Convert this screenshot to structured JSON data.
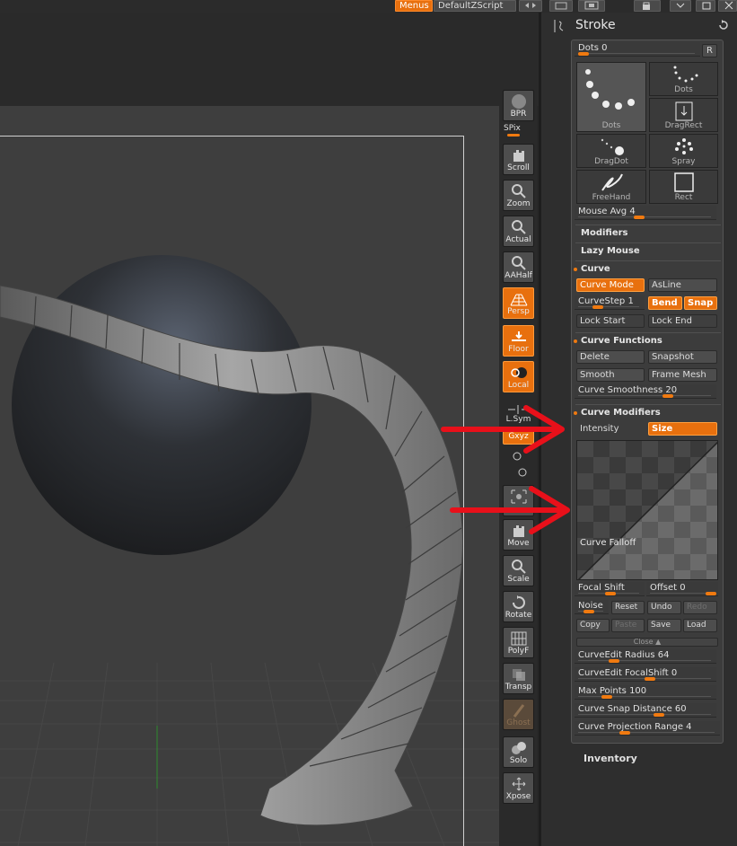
{
  "topbar": {
    "menus": "Menus",
    "script": "DefaultZScript"
  },
  "toolbar": {
    "items": [
      {
        "label": "BPR"
      },
      {
        "label": "SPix"
      },
      {
        "label": "Scroll"
      },
      {
        "label": "Zoom"
      },
      {
        "label": "Actual"
      },
      {
        "label": "AAHalf"
      },
      {
        "label": "Persp"
      },
      {
        "label": "Floor"
      },
      {
        "label": "Local"
      },
      {
        "label": "L.Sym"
      },
      {
        "label": "Gxyz"
      },
      {
        "label": "Frame"
      },
      {
        "label": "Move"
      },
      {
        "label": "Scale"
      },
      {
        "label": "Rotate"
      },
      {
        "label": "PolyF"
      },
      {
        "label": "Transp"
      },
      {
        "label": "Ghost"
      },
      {
        "label": "Solo"
      },
      {
        "label": "Xpose"
      }
    ]
  },
  "panel": {
    "title": "Stroke",
    "dots_slider": "Dots 0",
    "r_button": "R",
    "strokes": [
      "Dots",
      "Dots",
      "DragRect",
      "DragDot",
      "Spray",
      "FreeHand",
      "Rect"
    ],
    "mouse_avg": "Mouse Avg 4",
    "modifiers": "Modifiers",
    "lazy_mouse": "Lazy Mouse",
    "curve": "Curve",
    "curve_mode": "Curve Mode",
    "asline": "AsLine",
    "curvestep": "CurveStep 1",
    "bend": "Bend",
    "snap": "Snap",
    "lock_start": "Lock Start",
    "lock_end": "Lock End",
    "curve_functions": "Curve Functions",
    "delete": "Delete",
    "snapshot": "Snapshot",
    "smooth": "Smooth",
    "frame_mesh": "Frame Mesh",
    "curve_smoothness": "Curve Smoothness 20",
    "curve_modifiers": "Curve Modifiers",
    "intensity": "Intensity",
    "size": "Size",
    "curve_falloff": "Curve Falloff",
    "focal_shift": "Focal Shift",
    "offset": "Offset 0",
    "noise": "Noise",
    "reset": "Reset",
    "undo": "Undo",
    "redo": "Redo",
    "copy": "Copy",
    "paste": "Paste",
    "save": "Save",
    "load": "Load",
    "close": "Close",
    "curveedit_radius": "CurveEdit Radius 64",
    "curveedit_focalshift": "CurveEdit FocalShift 0",
    "max_points": "Max Points 100",
    "curve_snap_distance": "Curve Snap Distance 60",
    "curve_projection_range": "Curve Projection Range 4",
    "inventory": "Inventory"
  },
  "colors": {
    "accent": "#e8700e",
    "annotation_arrow": "#e8101a"
  },
  "slider_values": {
    "dots": 0,
    "mouse_avg": 4,
    "curvestep": 1,
    "curve_smoothness": 20,
    "offset": 0,
    "curveedit_radius": 64,
    "curveedit_focalshift": 0,
    "max_points": 100,
    "curve_snap_distance": 60,
    "curve_projection_range": 4
  }
}
